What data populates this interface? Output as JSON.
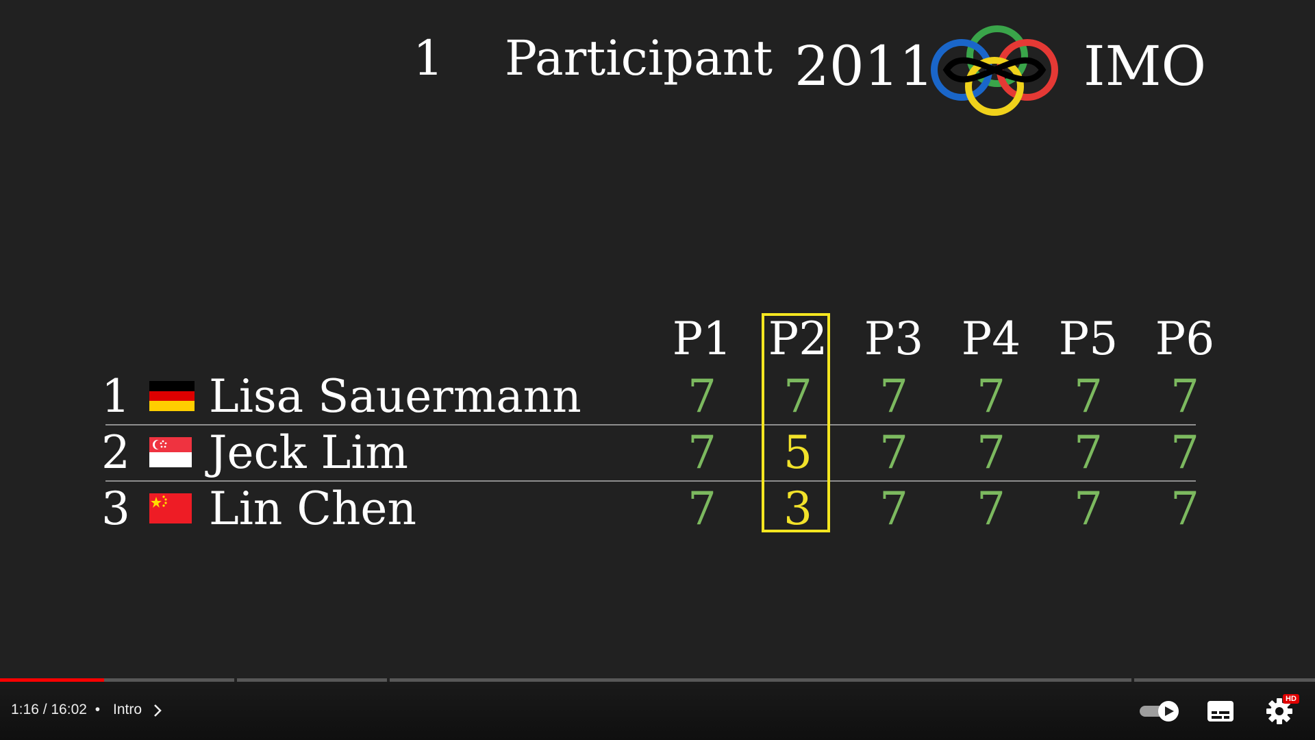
{
  "header": {
    "count": "1",
    "label": "Participant",
    "year": "2011",
    "event": "IMO",
    "logo_colors": [
      "#1a66c9",
      "#3aa54a",
      "#f0d21b",
      "#e53935",
      "#000000"
    ]
  },
  "table": {
    "problems": [
      "P1",
      "P2",
      "P3",
      "P4",
      "P5",
      "P6"
    ],
    "highlighted_problem": "P2",
    "rows": [
      {
        "rank": "1",
        "flag": "germany-flag",
        "name": "Lisa Sauermann",
        "scores": [
          "7",
          "7",
          "7",
          "7",
          "7",
          "7"
        ]
      },
      {
        "rank": "2",
        "flag": "singapore-flag",
        "name": "Jeck Lim",
        "scores": [
          "7",
          "5",
          "7",
          "7",
          "7",
          "7"
        ]
      },
      {
        "rank": "3",
        "flag": "china-flag",
        "name": "Lin Chen",
        "scores": [
          "7",
          "3",
          "7",
          "7",
          "7",
          "7"
        ]
      }
    ],
    "colors": {
      "full_score": "#7cb95f",
      "partial_score": "#f2e22a",
      "highlight_box": "#f4e620"
    }
  },
  "player": {
    "time": "1:16 / 16:02",
    "separator": "•",
    "chapter": "Intro",
    "hd_badge": "HD",
    "played_fraction": 0.079
  }
}
